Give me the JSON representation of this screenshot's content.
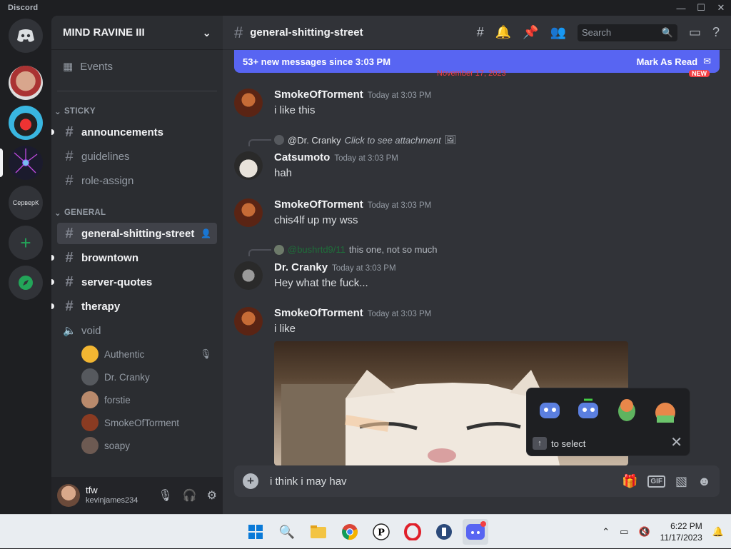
{
  "window": {
    "title": "Discord",
    "controls": [
      "minimize",
      "maximize",
      "close"
    ]
  },
  "servers": [
    {
      "name": "home",
      "icon": "discord-logo-icon"
    },
    {
      "name": "server-2"
    },
    {
      "name": "server-3"
    },
    {
      "name": "server-4"
    },
    {
      "name": "server-5",
      "label": "СерверК"
    },
    {
      "name": "add-server",
      "icon": "plus-icon"
    },
    {
      "name": "discover",
      "icon": "compass-icon"
    }
  ],
  "guild": {
    "name": "MIND RAVINE III"
  },
  "sidebar": {
    "events_label": "Events",
    "categories": [
      {
        "label": "STICKY",
        "channels": [
          {
            "name": "announcements",
            "unread": true
          },
          {
            "name": "guidelines",
            "unread": false
          },
          {
            "name": "role-assign",
            "unread": false
          }
        ]
      },
      {
        "label": "GENERAL",
        "channels": [
          {
            "name": "general-shitting-street",
            "active": true
          },
          {
            "name": "browntown",
            "unread": true
          },
          {
            "name": "server-quotes",
            "unread": true
          },
          {
            "name": "therapy",
            "unread": true
          }
        ]
      }
    ],
    "voice_channel": "void",
    "voice_users": [
      "Authentic",
      "Dr. Cranky",
      "forstie",
      "SmokeOfTorment",
      "soapy"
    ]
  },
  "user": {
    "display_name": "tfw",
    "username": "kevinjames234"
  },
  "channel": {
    "name": "general-shitting-street",
    "search_placeholder": "Search"
  },
  "new_messages_bar": {
    "text": "53+ new messages since 3:03 PM",
    "action": "Mark As Read"
  },
  "date_divider": "November 17, 2023",
  "new_badge": "NEW",
  "messages": [
    {
      "author": "SmokeOfTorment",
      "time": "Today at 3:03 PM",
      "text": "i like this"
    },
    {
      "reply_to": "@Dr. Cranky",
      "reply_text": "Click to see attachment",
      "author": "Catsumoto",
      "time": "Today at 3:03 PM",
      "text": "hah"
    },
    {
      "author": "SmokeOfTorment",
      "time": "Today at 3:03 PM",
      "text": "chis4lf up my wss"
    },
    {
      "reply_to": "@bushrtd9/11",
      "reply_text": "this one, not so much",
      "author": "Dr. Cranky",
      "time": "Today at 3:03 PM",
      "text": "Hey what the fuck..."
    },
    {
      "author": "SmokeOfTorment",
      "time": "Today at 3:03 PM",
      "text": "i like"
    }
  ],
  "sticker_popup": {
    "hint": "to select",
    "key": "↑"
  },
  "composer": {
    "value": "i think i may hav"
  },
  "taskbar": {
    "time": "6:22 PM",
    "date": "11/17/2023"
  },
  "colors": {
    "accent": "#5865f2",
    "online": "#23a559",
    "bg": "#313338"
  }
}
